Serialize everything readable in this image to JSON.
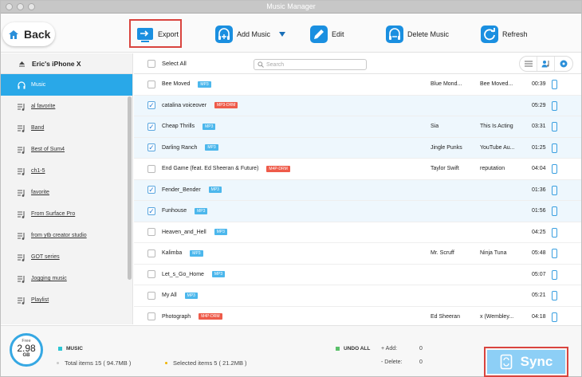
{
  "window": {
    "title": "Music Manager"
  },
  "toolbar": {
    "back_label": "Back",
    "export_label": "Export",
    "add_music_label": "Add Music",
    "edit_label": "Edit",
    "delete_label": "Delete Music",
    "refresh_label": "Refresh"
  },
  "sidebar": {
    "device": "Eric's iPhone X",
    "items": [
      {
        "label": "Music",
        "icon": "headphones-icon",
        "active": true
      },
      {
        "label": "al favorite",
        "icon": "playlist-icon"
      },
      {
        "label": "Band",
        "icon": "playlist-icon"
      },
      {
        "label": "Best of Sum4",
        "icon": "playlist-icon"
      },
      {
        "label": "ch1-5",
        "icon": "playlist-icon"
      },
      {
        "label": "favorite",
        "icon": "playlist-icon"
      },
      {
        "label": "From Surface Pro",
        "icon": "playlist-icon"
      },
      {
        "label": "from ytb creator studio",
        "icon": "playlist-icon"
      },
      {
        "label": "GOT series",
        "icon": "playlist-icon"
      },
      {
        "label": "Jogging music",
        "icon": "playlist-icon"
      },
      {
        "label": "Playlist",
        "icon": "playlist-icon"
      }
    ]
  },
  "list": {
    "select_all": "Select All",
    "search_placeholder": "Search",
    "rows": [
      {
        "name": "Bee Moved",
        "tag": "MP3",
        "artist": "Blue Mond...",
        "album": "Bee Moved...",
        "duration": "00:39",
        "checked": false
      },
      {
        "name": "catalina voiceover",
        "tag": "MP3-DRM",
        "artist": "",
        "album": "",
        "duration": "05:29",
        "checked": true
      },
      {
        "name": "Cheap Thrills",
        "tag": "MP3",
        "artist": "Sia",
        "album": "This Is Acting",
        "duration": "03:31",
        "checked": true
      },
      {
        "name": "Darling Ranch",
        "tag": "MP3",
        "artist": "Jingle Punks",
        "album": "YouTube Au...",
        "duration": "01:25",
        "checked": true
      },
      {
        "name": "End Game (feat. Ed Sheeran & Future)",
        "tag": "M4P-DRM",
        "artist": "Taylor Swift",
        "album": "reputation",
        "duration": "04:04",
        "checked": false
      },
      {
        "name": "Fender_Bender",
        "tag": "MP3",
        "artist": "",
        "album": "",
        "duration": "01:36",
        "checked": true
      },
      {
        "name": "Funhouse",
        "tag": "MP3",
        "artist": "",
        "album": "",
        "duration": "01:56",
        "checked": true
      },
      {
        "name": "Heaven_and_Hell",
        "tag": "MP3",
        "artist": "",
        "album": "",
        "duration": "04:25",
        "checked": false
      },
      {
        "name": "Kalimba",
        "tag": "MP3",
        "artist": "Mr. Scruff",
        "album": "Ninja Tuna",
        "duration": "05:48",
        "checked": false
      },
      {
        "name": "Let_s_Go_Home",
        "tag": "MP3",
        "artist": "",
        "album": "",
        "duration": "05:07",
        "checked": false
      },
      {
        "name": "My All",
        "tag": "MP3",
        "artist": "",
        "album": "",
        "duration": "05:21",
        "checked": false
      },
      {
        "name": "Photograph",
        "tag": "M4P-DRM",
        "artist": "Ed Sheeran",
        "album": "x (Wembley...",
        "duration": "04:18",
        "checked": false
      }
    ]
  },
  "footer": {
    "storage_free_label": "Free",
    "storage_amount": "2.98",
    "storage_unit": "GB",
    "music_label": "MUSIC",
    "total_items": "Total items 15 ( 94.7MB )",
    "selected_items": "Selected items 5 ( 21.2MB )",
    "undo_all": "UNDO ALL",
    "add_label": "+ Add:",
    "add_count": "0",
    "delete_label": "- Delete:",
    "delete_count": "0",
    "sync_label": "Sync"
  },
  "colors": {
    "accent": "#29a8e8",
    "mp3_tag": "#4cb7ec",
    "drm_tag": "#ee5b4a",
    "highlight_box": "#d9443e",
    "music_square": "#2cc6d4",
    "undo_square": "#5ac06a",
    "selected_dot": "#f0b400"
  }
}
